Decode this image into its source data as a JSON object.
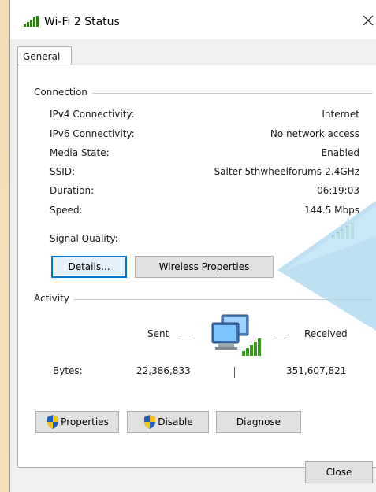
{
  "window": {
    "title": "Wi-Fi 2 Status",
    "icon": "wifi-signal-icon",
    "close_icon": "close-icon"
  },
  "tabs": [
    {
      "label": "General",
      "selected": true
    }
  ],
  "connection": {
    "heading": "Connection",
    "rows": [
      {
        "label": "IPv4 Connectivity:",
        "value": "Internet"
      },
      {
        "label": "IPv6 Connectivity:",
        "value": "No network access"
      },
      {
        "label": "Media State:",
        "value": "Enabled"
      },
      {
        "label": "SSID:",
        "value": "Salter-5thwheelforums-2.4GHz"
      },
      {
        "label": "Duration:",
        "value": "06:19:03"
      },
      {
        "label": "Speed:",
        "value": "144.5 Mbps"
      }
    ],
    "signal_quality_label": "Signal Quality:",
    "signal_bars": 5,
    "signal_bars_max": 5,
    "details_button": "Details...",
    "wireless_properties_button": "Wireless Properties"
  },
  "activity": {
    "heading": "Activity",
    "sent_label": "Sent",
    "received_label": "Received",
    "bytes_label": "Bytes:",
    "bytes_sent": "22,386,833",
    "bytes_received": "351,607,821",
    "network_icon": "network-computers-icon"
  },
  "buttons": {
    "properties": "Properties",
    "disable": "Disable",
    "diagnose": "Diagnose",
    "close": "Close",
    "shield_icon": "uac-shield-icon"
  },
  "colors": {
    "focus_border": "#0078d7",
    "signal_green": "#3a9c1c",
    "button_face": "#e1e1e1",
    "panel_bg": "#ffffff",
    "dialog_bg": "#f0f0f0"
  }
}
